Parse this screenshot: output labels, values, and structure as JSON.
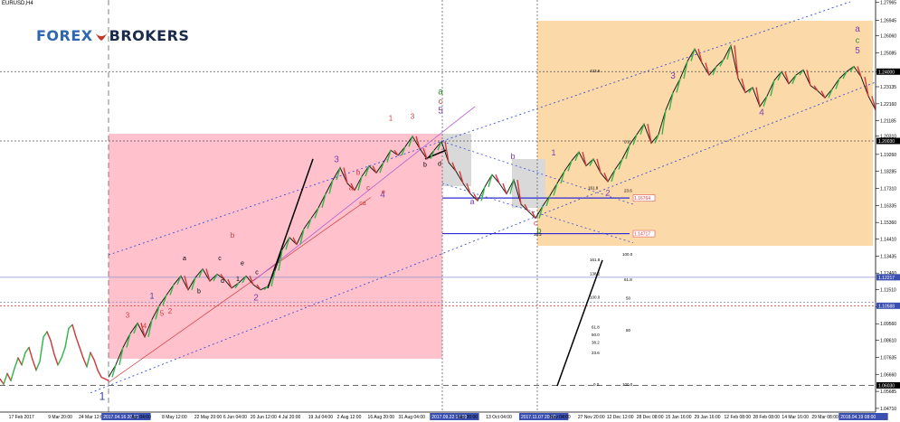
{
  "symbol": "EURUSD,H4",
  "logo": {
    "part1": "FOREX",
    "part2": "BROKERS"
  },
  "chart_data": {
    "type": "line",
    "title": "",
    "ylim": [
      1.045,
      1.28
    ],
    "price_ticks": [
      "1.27965",
      "1.26945",
      "1.26060",
      "1.25085",
      "1.24000",
      "1.23135",
      "1.22160",
      "1.21185",
      "1.20310",
      "1.19260",
      "1.18285",
      "1.17310",
      "1.16335",
      "1.15360",
      "1.14410",
      "1.13435",
      "1.12460",
      "1.11510",
      "1.10535",
      "1.09560",
      "1.08610",
      "1.07635",
      "1.06660",
      "1.05685",
      "1.04710"
    ],
    "price_tick_values": [
      1.27965,
      1.26945,
      1.2606,
      1.25085,
      1.24,
      1.23135,
      1.2216,
      1.21185,
      1.2031,
      1.1926,
      1.18285,
      1.1731,
      1.16335,
      1.1536,
      1.1441,
      1.13435,
      1.1246,
      1.1151,
      1.10535,
      1.0956,
      1.0861,
      1.07635,
      1.0666,
      1.05685,
      1.0471
    ],
    "price_labels": [
      {
        "text": "1.24000",
        "value": 1.24,
        "color": "#000000"
      },
      {
        "text": "1.20030",
        "value": 1.2003,
        "color": "#000000"
      },
      {
        "text": "1.12217",
        "value": 1.1222,
        "color": "#3b4fb0"
      },
      {
        "text": "1.10588",
        "value": 1.1059,
        "color": "#3b4fb0"
      },
      {
        "text": "1.06030",
        "value": 1.0603,
        "color": "#000000"
      }
    ],
    "x_labels": [
      "17 Feb 2017",
      "9 Mar 20:00",
      "24 Mar 12:00",
      "2017.04.16 20:00",
      "Apr 04:00",
      "8 May 12:00",
      "22 May 20:00",
      "6 Jun 04:00",
      "20 Jun 12:00",
      "4 Jul 20:00",
      "19 Jul 04:00",
      "2 Aug 12:00",
      "16 Aug 20:00",
      "31 Aug 04:00",
      "2017.09.22 12:00",
      "Sep 20:00",
      "13 Oct 04:00",
      "2017.11.07 20:00",
      "Nov 04:00",
      "27 Nov 20:00",
      "12 Dec 12:00",
      "28 Dec 08:00",
      "15 Jan 16:00",
      "29 Jan 16:00",
      "12 Feb 08:00",
      "28 Feb 08:00",
      "14 Mar 16:00",
      "29 Mar 08:00",
      "2018.04.19 08:00"
    ],
    "x_label_pos": [
      0.01,
      0.055,
      0.09,
      0.118,
      0.15,
      0.185,
      0.222,
      0.255,
      0.286,
      0.318,
      0.352,
      0.385,
      0.42,
      0.455,
      0.493,
      0.522,
      0.555,
      0.595,
      0.628,
      0.66,
      0.693,
      0.727,
      0.76,
      0.793,
      0.827,
      0.86,
      0.893,
      0.927,
      0.96
    ],
    "series": [
      {
        "x": [
          0,
          4,
          8,
          12,
          16,
          20,
          24,
          28,
          32,
          36,
          40,
          44,
          48,
          52,
          56,
          60,
          64,
          68,
          72,
          76,
          80,
          84,
          88,
          92,
          96,
          100,
          104,
          108,
          112,
          116,
          120
        ],
        "values": [
          1.064,
          1.061,
          1.067,
          1.063,
          1.07,
          1.076,
          1.072,
          1.079,
          1.082,
          1.075,
          1.069,
          1.074,
          1.088,
          1.091,
          1.086,
          1.078,
          1.072,
          1.076,
          1.082,
          1.093,
          1.095,
          1.088,
          1.082,
          1.076,
          1.071,
          1.079,
          1.075,
          1.069,
          1.065,
          1.064,
          1.063
        ]
      },
      {
        "x": [
          120,
          128,
          136,
          144,
          152,
          160,
          168,
          176,
          184,
          192,
          200,
          208,
          216,
          224,
          232,
          240,
          248,
          256,
          264,
          272,
          280,
          288,
          296
        ],
        "values": [
          1.065,
          1.072,
          1.082,
          1.09,
          1.096,
          1.088,
          1.098,
          1.106,
          1.112,
          1.118,
          1.123,
          1.115,
          1.122,
          1.127,
          1.12,
          1.124,
          1.121,
          1.116,
          1.119,
          1.123,
          1.118,
          1.115,
          1.117
        ]
      },
      {
        "x": [
          296,
          304,
          312,
          320,
          328,
          336,
          344,
          352,
          360,
          368,
          376,
          384,
          392,
          400,
          408,
          416,
          424,
          432,
          440,
          448,
          456,
          464,
          472,
          480,
          488
        ],
        "values": [
          1.117,
          1.126,
          1.138,
          1.145,
          1.141,
          1.15,
          1.156,
          1.162,
          1.17,
          1.178,
          1.185,
          1.176,
          1.172,
          1.18,
          1.186,
          1.182,
          1.188,
          1.195,
          1.192,
          1.197,
          1.203,
          1.196,
          1.19,
          1.195,
          1.2
        ]
      },
      {
        "x": [
          488,
          496,
          504,
          512,
          520,
          528,
          536,
          544,
          552,
          560,
          568,
          576,
          584,
          592,
          600,
          608
        ],
        "values": [
          1.2,
          1.188,
          1.183,
          1.176,
          1.17,
          1.166,
          1.174,
          1.181,
          1.176,
          1.17,
          1.178,
          1.164,
          1.16,
          1.156,
          1.163,
          1.169
        ]
      },
      {
        "x": [
          608,
          616,
          624,
          632,
          640,
          648,
          656,
          664,
          672,
          680,
          688,
          696,
          704,
          712,
          720,
          728,
          736,
          744,
          752,
          760,
          768,
          776,
          784,
          792,
          800,
          808,
          816,
          824,
          832,
          840,
          848,
          856,
          864,
          872,
          880,
          888,
          896,
          904,
          912,
          920,
          928,
          936,
          944,
          952,
          960,
          968
        ],
        "values": [
          1.169,
          1.176,
          1.183,
          1.189,
          1.194,
          1.186,
          1.19,
          1.182,
          1.177,
          1.184,
          1.19,
          1.198,
          1.204,
          1.21,
          1.199,
          1.204,
          1.218,
          1.228,
          1.236,
          1.246,
          1.253,
          1.245,
          1.238,
          1.243,
          1.247,
          1.255,
          1.236,
          1.228,
          1.231,
          1.22,
          1.226,
          1.235,
          1.24,
          1.233,
          1.238,
          1.241,
          1.232,
          1.229,
          1.225,
          1.23,
          1.236,
          1.24,
          1.243,
          1.237,
          1.226,
          1.218
        ]
      }
    ],
    "wave_labels": [
      {
        "text": "1",
        "x": 113,
        "v": 1.052,
        "color": "#3b3fa8",
        "size": 12
      },
      {
        "text": "3",
        "x": 141,
        "v": 1.099,
        "color": "#d33a3a",
        "size": 8
      },
      {
        "text": "4",
        "x": 160,
        "v": 1.093,
        "color": "#d33a3a",
        "size": 8
      },
      {
        "text": "1",
        "x": 168,
        "v": 1.11,
        "color": "#3b3fa8",
        "size": 9
      },
      {
        "text": "5",
        "x": 179,
        "v": 1.1,
        "color": "#d33a3a",
        "size": 8
      },
      {
        "text": "2",
        "x": 188,
        "v": 1.1015,
        "color": "#d33a3a",
        "size": 8
      },
      {
        "text": "a",
        "x": 204,
        "v": 1.132,
        "color": "#000000",
        "size": 7
      },
      {
        "text": "b",
        "x": 220,
        "v": 1.113,
        "color": "#000000",
        "size": 7
      },
      {
        "text": "c",
        "x": 243,
        "v": 1.132,
        "color": "#000000",
        "size": 7
      },
      {
        "text": "b",
        "x": 257,
        "v": 1.145,
        "color": "#d33a3a",
        "size": 8
      },
      {
        "text": "d",
        "x": 246,
        "v": 1.119,
        "color": "#000000",
        "size": 7
      },
      {
        "text": "e",
        "x": 268,
        "v": 1.129,
        "color": "#000000",
        "size": 7
      },
      {
        "text": "c",
        "x": 284,
        "v": 1.124,
        "color": "#000000",
        "size": 7
      },
      {
        "text": "2",
        "x": 283,
        "v": 1.109,
        "color": "#7b3fb0",
        "size": 10
      },
      {
        "text": "1",
        "x": 263,
        "v": 1.12,
        "color": "#000000",
        "size": 7
      },
      {
        "text": "3",
        "x": 372,
        "v": 1.188,
        "color": "#7b3fb0",
        "size": 10
      },
      {
        "text": "b",
        "x": 396,
        "v": 1.181,
        "color": "#d33a3a",
        "size": 8
      },
      {
        "text": "a",
        "x": 388,
        "v": 1.172,
        "color": "#d33a3a",
        "size": 8
      },
      {
        "text": "c",
        "x": 407,
        "v": 1.172,
        "color": "#d33a3a",
        "size": 8
      },
      {
        "text": "ca",
        "x": 401,
        "v": 1.1635,
        "color": "#d33a3a",
        "size": 7
      },
      {
        "text": "4",
        "x": 423,
        "v": 1.168,
        "color": "#7b3fb0",
        "size": 10
      },
      {
        "text": "e",
        "x": 424,
        "v": 1.17,
        "color": "#d33a3a",
        "size": 7
      },
      {
        "text": "1",
        "x": 432,
        "v": 1.212,
        "color": "#d33a3a",
        "size": 8
      },
      {
        "text": "3",
        "x": 456,
        "v": 1.213,
        "color": "#d33a3a",
        "size": 8
      },
      {
        "text": "a",
        "x": 487,
        "v": 1.227,
        "color": "#2a8a2a",
        "size": 10
      },
      {
        "text": "c",
        "x": 487,
        "v": 1.2215,
        "color": "#d33a3a",
        "size": 9
      },
      {
        "text": "5",
        "x": 487,
        "v": 1.216,
        "color": "#7b3fb0",
        "size": 10
      },
      {
        "text": "b",
        "x": 470,
        "v": 1.1855,
        "color": "#000000",
        "size": 7
      },
      {
        "text": "d",
        "x": 486,
        "v": 1.186,
        "color": "#000000",
        "size": 7
      },
      {
        "text": "b",
        "x": 567,
        "v": 1.19,
        "color": "#7b3fb0",
        "size": 9
      },
      {
        "text": "a",
        "x": 522,
        "v": 1.164,
        "color": "#7b3fb0",
        "size": 9
      },
      {
        "text": "c",
        "x": 592,
        "v": 1.152,
        "color": "#d33a3a",
        "size": 8
      },
      {
        "text": "b",
        "x": 596,
        "v": 1.1475,
        "color": "#2a8a2a",
        "size": 9
      },
      {
        "text": "1",
        "x": 612,
        "v": 1.192,
        "color": "#7b3fb0",
        "size": 9
      },
      {
        "text": "2",
        "x": 672,
        "v": 1.169,
        "color": "#7b3fb0",
        "size": 9
      },
      {
        "text": "3",
        "x": 744,
        "v": 1.236,
        "color": "#7b3fb0",
        "size": 10
      },
      {
        "text": "4",
        "x": 842,
        "v": 1.215,
        "color": "#7b3fb0",
        "size": 10
      },
      {
        "text": "a",
        "x": 948,
        "v": 1.263,
        "color": "#7b3fb0",
        "size": 10
      },
      {
        "text": "c",
        "x": 948,
        "v": 1.2565,
        "color": "#2a8a2a",
        "size": 9
      },
      {
        "text": "5",
        "x": 948,
        "v": 1.2505,
        "color": "#7b3fb0",
        "size": 10
      }
    ],
    "fib_labels_right": [
      {
        "text": "0.0",
        "x": 690,
        "v": 1.199
      },
      {
        "text": "23.6",
        "x": 690,
        "v": 1.171
      },
      {
        "text": "100.0",
        "x": 688,
        "v": 1.1345
      },
      {
        "text": "61.8",
        "x": 690,
        "v": 1.12
      },
      {
        "text": "50",
        "x": 692,
        "v": 1.1095
      },
      {
        "text": "80",
        "x": 692,
        "v": 1.091
      },
      {
        "text": "100.0",
        "x": 688,
        "v": 1.06
      },
      {
        "text": "123.6",
        "x": 686,
        "v": 1.029
      },
      {
        "text": "161.8",
        "x": 652,
        "v": 1.1315
      },
      {
        "text": "138.2",
        "x": 652,
        "v": 1.1235
      },
      {
        "text": "100.0",
        "x": 652,
        "v": 1.11
      },
      {
        "text": "61.8",
        "x": 654,
        "v": 1.093
      },
      {
        "text": "50.0",
        "x": 654,
        "v": 1.0885
      },
      {
        "text": "38.2",
        "x": 654,
        "v": 1.084
      },
      {
        "text": "23.6",
        "x": 654,
        "v": 1.078
      },
      {
        "text": "0.0",
        "x": 656,
        "v": 1.06
      },
      {
        "text": "161.8",
        "x": 650,
        "v": 1.1725
      },
      {
        "text": "38.2",
        "x": 590,
        "v": 1.146
      },
      {
        "text": "423.6",
        "x": 652,
        "v": 1.2395
      }
    ],
    "fib_tags": [
      {
        "text": "1.16764",
        "v": 1.1676
      },
      {
        "text": "1.14717",
        "v": 1.1472
      }
    ]
  }
}
